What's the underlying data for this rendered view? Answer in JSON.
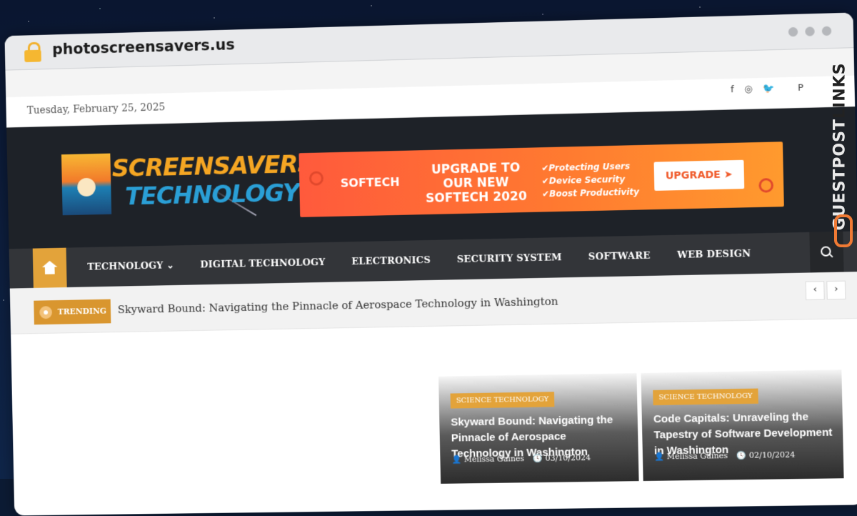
{
  "browser": {
    "url": "photoscreensavers.us"
  },
  "topbar": {
    "date": "Tuesday, February 25, 2025",
    "social": [
      "f",
      "◎",
      "🐦",
      "P"
    ]
  },
  "logo": {
    "line1": "SCREENSAVERS",
    "line2": "TECHNOLOGY"
  },
  "banner": {
    "brand": "SOFTECH",
    "headline": "UPGRADE TO OUR NEW SOFTECH 2020",
    "checks": [
      "✔Protecting Users",
      "✔Device Security",
      "✔Boost Productivity"
    ],
    "cta": "UPGRADE ➤",
    "colors": {
      "start": "#ff5a3c",
      "end": "#ff9a2e"
    }
  },
  "nav": {
    "items": [
      "TECHNOLOGY ⌄",
      "DIGITAL TECHNOLOGY",
      "ELECTRONICS",
      "SECURITY SYSTEM",
      "SOFTWARE",
      "WEB DESIGN"
    ],
    "accent": "#e3a33a"
  },
  "trending": {
    "label": "TRENDING",
    "headline": "Skyward Bound: Navigating the Pinnacle of Aerospace Technology in Washington",
    "prev": "‹",
    "next": "›"
  },
  "cards": [
    {
      "category": "SCIENCE TECHNOLOGY",
      "title": "Skyward Bound: Navigating the Pinnacle of Aerospace Technology in Washington",
      "author": "Melissa Gaines",
      "date": "03/10/2024"
    },
    {
      "category": "SCIENCE TECHNOLOGY",
      "title": "Code Capitals: Unraveling the Tapestry of Software Development in Washington",
      "author": "Melissa Gaines",
      "date": "02/10/2024"
    }
  ],
  "watermark": {
    "part1": "GUESTPOST",
    "part2": "LINKS"
  }
}
